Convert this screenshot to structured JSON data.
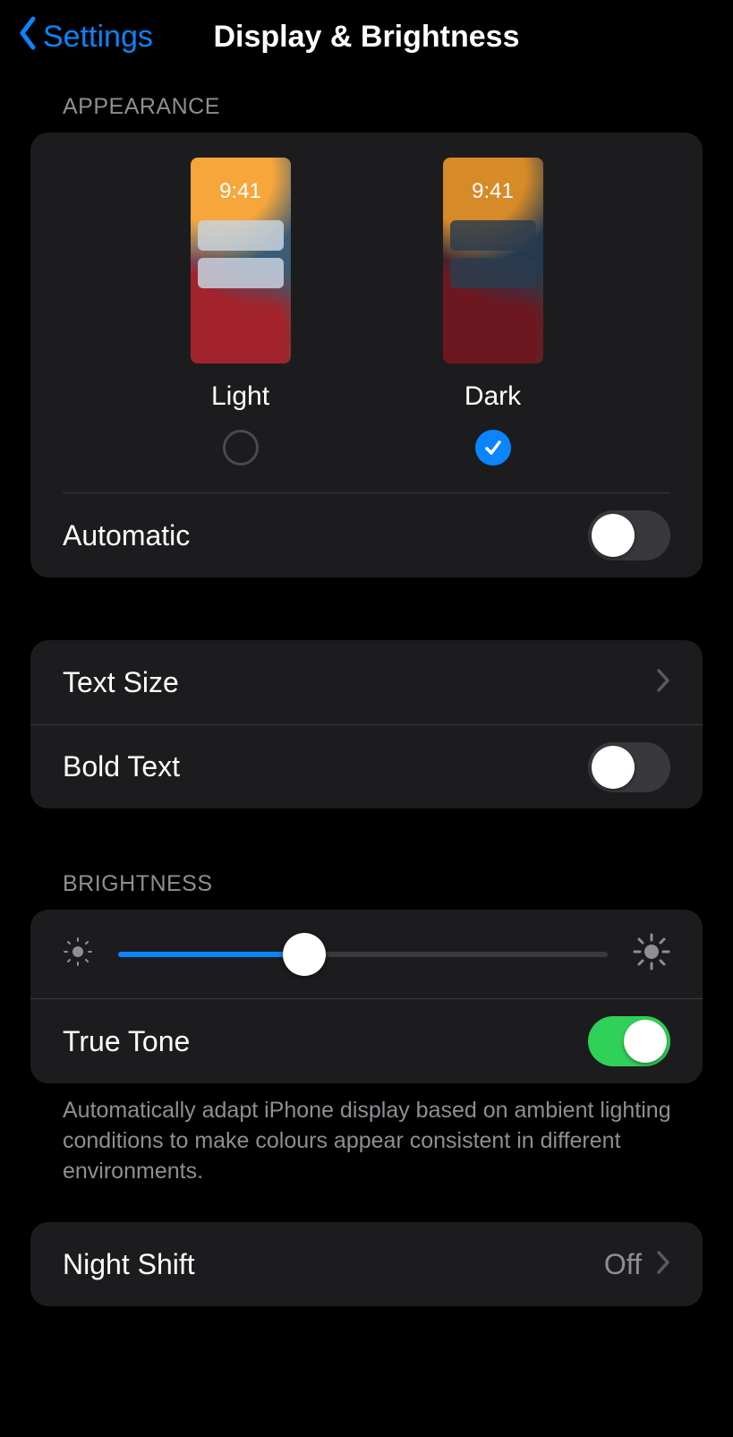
{
  "nav": {
    "back_label": "Settings",
    "title": "Display & Brightness"
  },
  "appearance": {
    "header": "APPEARANCE",
    "clock": "9:41",
    "options": {
      "light": {
        "label": "Light",
        "selected": false
      },
      "dark": {
        "label": "Dark",
        "selected": true
      }
    },
    "automatic": {
      "label": "Automatic",
      "enabled": false
    }
  },
  "text": {
    "text_size": {
      "label": "Text Size"
    },
    "bold_text": {
      "label": "Bold Text",
      "enabled": false
    }
  },
  "brightness": {
    "header": "BRIGHTNESS",
    "level_percent": 38,
    "true_tone": {
      "label": "True Tone",
      "enabled": true
    },
    "footer": "Automatically adapt iPhone display based on ambient lighting conditions to make colours appear consistent in different environments."
  },
  "night_shift": {
    "label": "Night Shift",
    "value": "Off"
  },
  "colors": {
    "accent": "#0a84ff",
    "toggle_on": "#30d158"
  }
}
